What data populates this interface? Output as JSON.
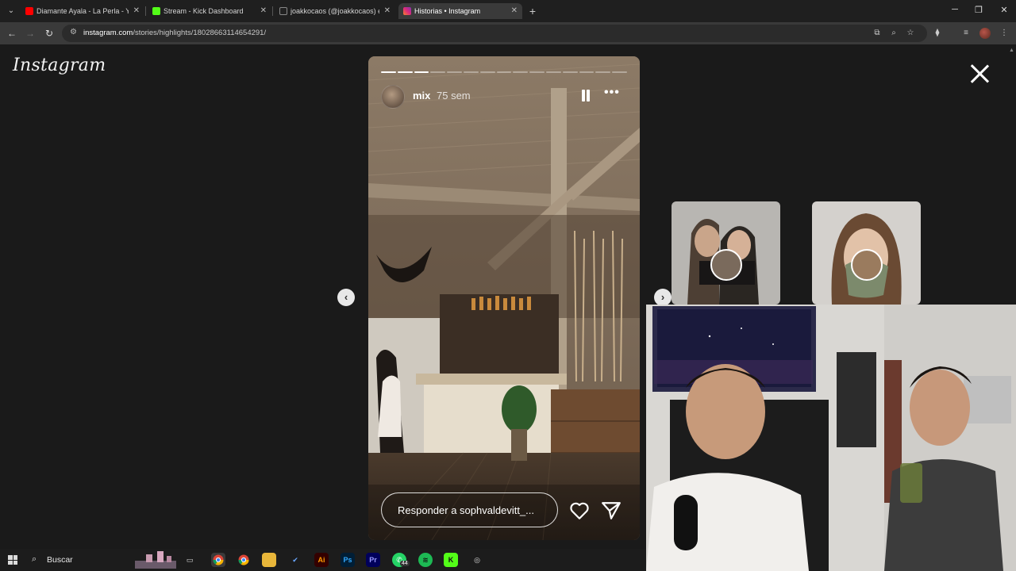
{
  "browser": {
    "tabs": [
      {
        "title": "Diamante Ayala - La Perla - You",
        "favicon": "youtube-icon",
        "color": "#ff0000"
      },
      {
        "title": "Stream - Kick Dashboard",
        "favicon": "kick-icon",
        "color": "#53fc18"
      },
      {
        "title": "joakkocaos (@joakkocaos) esti",
        "favicon": "tiktok-icon",
        "color": "#222222"
      },
      {
        "title": "Historias • Instagram",
        "favicon": "instagram-icon",
        "color": "#d6249f",
        "active": true
      }
    ],
    "url_host": "instagram.com",
    "url_path": "/stories/highlights/18028663114654291/"
  },
  "instagram": {
    "logo": "Instagram",
    "story": {
      "username": "mix",
      "time_ago": "75 sem",
      "segments_total": 15,
      "segments_done": 3,
      "reply_placeholder": "Responder a sophvaldevitt_..."
    }
  },
  "taskbar": {
    "search_placeholder": "Buscar",
    "whatsapp_badge": "44",
    "apps": [
      "task-view-icon",
      "chrome-icon",
      "chrome-icon",
      "file-explorer-icon",
      "ticktick-icon",
      "illustrator-icon",
      "photoshop-icon",
      "premiere-icon",
      "whatsapp-icon",
      "spotify-icon",
      "kick-icon",
      "chrome-dev-icon"
    ]
  },
  "colors": {
    "instagram_bg": "#1a1a1a",
    "browser_tabstrip": "#1f1f1f",
    "browser_toolbar": "#3a3a3a"
  }
}
